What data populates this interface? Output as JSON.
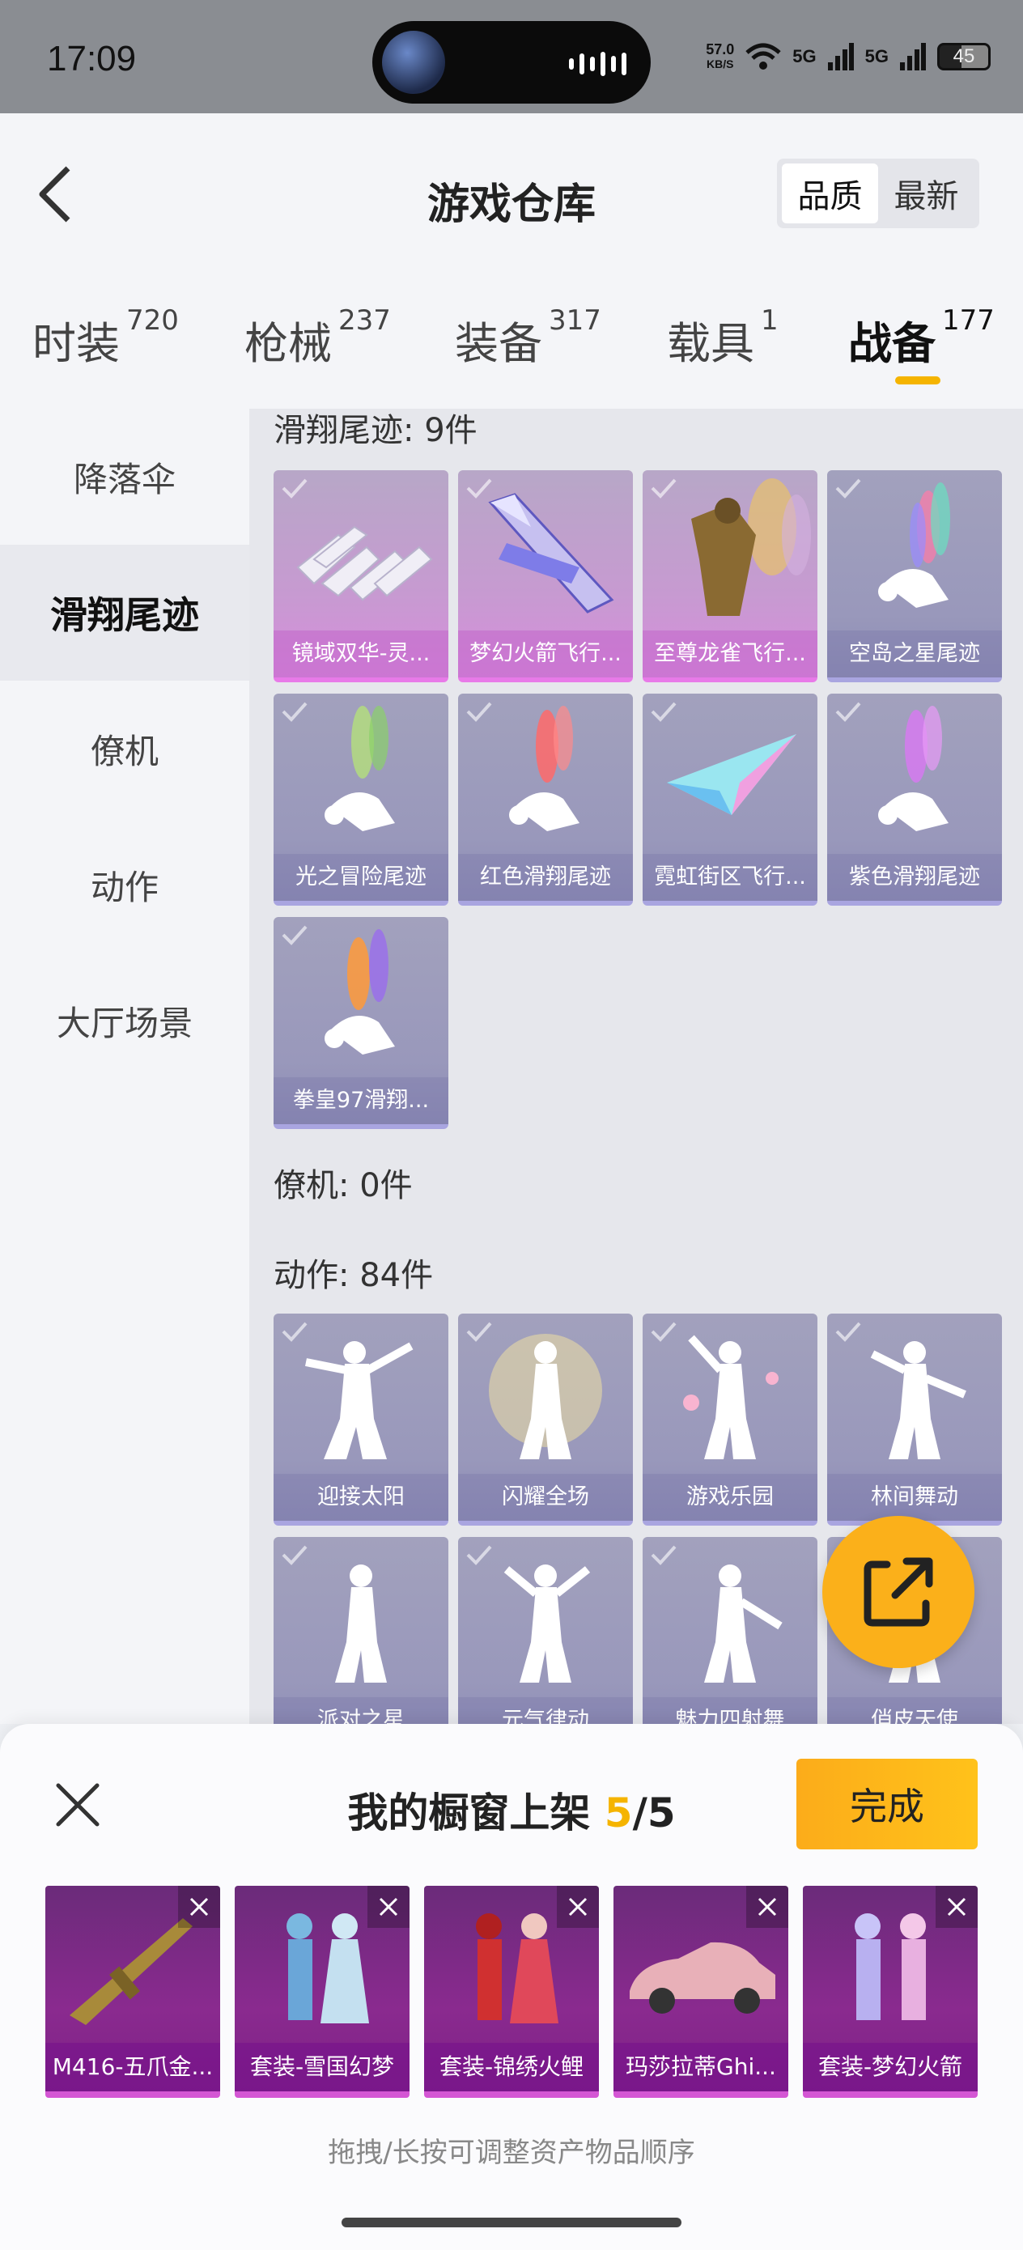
{
  "status": {
    "time": "17:09",
    "speed_value": "57.0",
    "speed_unit": "KB/S",
    "signal_1": "5G",
    "signal_2": "5G",
    "battery": "45"
  },
  "header": {
    "title": "游戏仓库",
    "sort_quality": "品质",
    "sort_latest": "最新"
  },
  "tabs": [
    {
      "label": "时装",
      "count": "720"
    },
    {
      "label": "枪械",
      "count": "237"
    },
    {
      "label": "装备",
      "count": "317"
    },
    {
      "label": "载具",
      "count": "1"
    },
    {
      "label": "战备",
      "count": "177",
      "active": true
    }
  ],
  "sidebar": {
    "items": [
      "降落伞",
      "滑翔尾迹",
      "僚机",
      "动作",
      "大厅场景"
    ],
    "active": "滑翔尾迹"
  },
  "sections": {
    "glide_title": "滑翔尾迹: 9件",
    "wingman_title": "僚机: 0件",
    "action_title": "动作: 84件"
  },
  "glide_items": [
    "镜域双华-灵...",
    "梦幻火箭飞行...",
    "至尊龙雀飞行...",
    "空岛之星尾迹",
    "光之冒险尾迹",
    "红色滑翔尾迹",
    "霓虹街区飞行...",
    "紫色滑翔尾迹",
    "拳皇97滑翔..."
  ],
  "action_items": [
    "迎接太阳",
    "闪耀全场",
    "游戏乐园",
    "林间舞动",
    "派对之星",
    "元气律动",
    "魅力四射舞",
    "俏皮天使"
  ],
  "panel": {
    "title": "我的橱窗上架",
    "count_current": "5",
    "count_total": "/5",
    "done": "完成",
    "shelf": [
      "M416-五爪金...",
      "套装-雪国幻梦",
      "套装-锦绣火鲤",
      "玛莎拉蒂Ghi...",
      "套装-梦幻火箭"
    ],
    "hint": "拖拽/长按可调整资产物品顺序"
  },
  "colors": {
    "accent": "#f5b400",
    "done_button": "#fcb21a",
    "legendary_border": "#e87ae8"
  }
}
